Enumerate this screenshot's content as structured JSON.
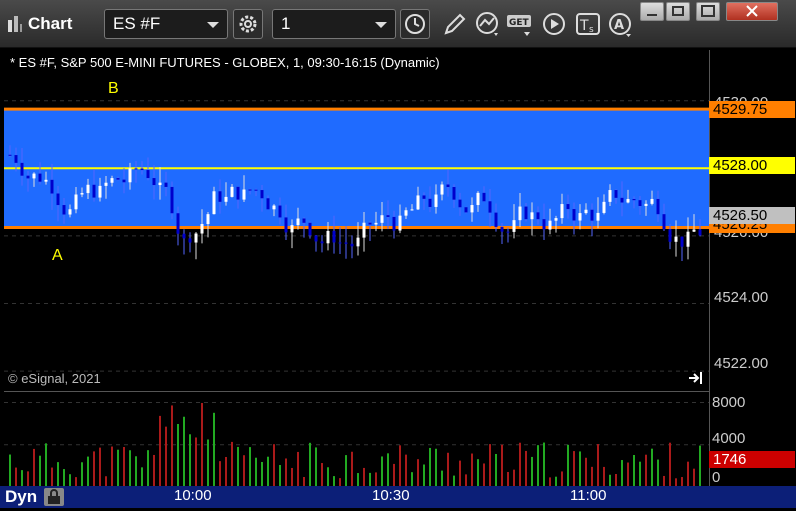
{
  "window": {
    "title": "Chart",
    "symbol": "ES #F",
    "interval": "1"
  },
  "chart_desc": "* ES #F, S&P 500 E-MINI FUTURES - GLOBEX, 1, 09:30-16:15 (Dynamic)",
  "copyright": "© eSignal, 2021",
  "labels": {
    "a": "A",
    "b": "B"
  },
  "price_axis": {
    "ticks": [
      "4530.00",
      "4528.00",
      "4526.00",
      "4524.00",
      "4522.00"
    ],
    "tag_top": "4529.75",
    "tag_mid": "4528.00",
    "tag_last": "4526.50",
    "tag_low": "4526.25"
  },
  "volume_axis": {
    "ticks": [
      "8000",
      "4000",
      "0"
    ],
    "last": "1746"
  },
  "time_axis": {
    "ticks": [
      "10:00",
      "10:30",
      "11:00"
    ]
  },
  "bottom": {
    "mode": "Dyn"
  },
  "colors": {
    "band": "#1f6bff",
    "band_edge": "#ff7f00",
    "mid_line": "#ffff00",
    "up_candle": "#ffffff",
    "down_candle": "#0000cc",
    "vol_up": "#22aa22",
    "vol_down": "#aa1a1a",
    "tag_last": "#c0c0c0",
    "tag_vol": "#cc0000"
  },
  "chart_data": {
    "type": "candlestick",
    "ylim": [
      4521.5,
      4531.5
    ],
    "band": {
      "top": 4529.75,
      "mid": 4528.0,
      "bottom": 4526.25
    },
    "last_price": 4526.5,
    "volume_ylim": [
      0,
      9000
    ],
    "last_volume": 1746,
    "annotations": [
      {
        "text": "A",
        "price": 4525.75
      },
      {
        "text": "B",
        "price": 4530.65
      }
    ]
  }
}
